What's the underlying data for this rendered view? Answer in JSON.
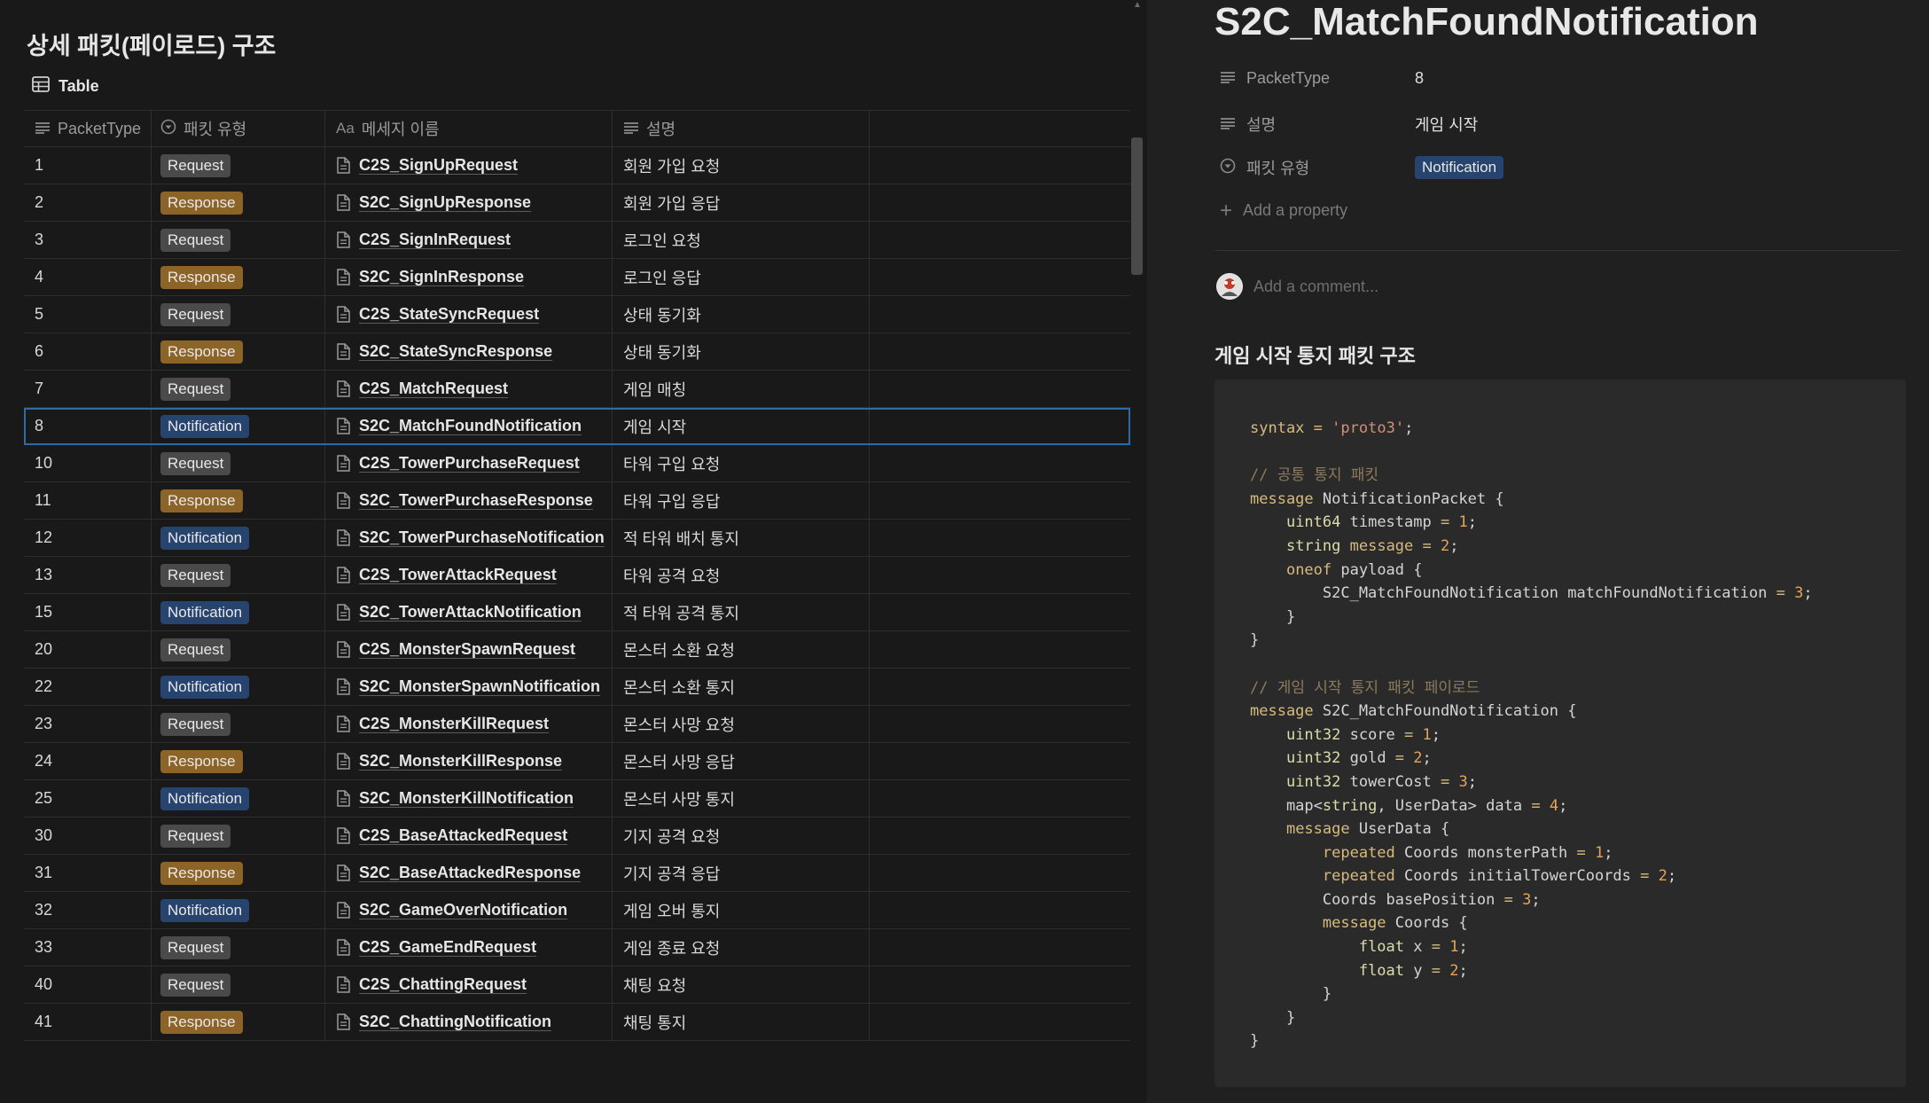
{
  "database": {
    "title": "상세 패킷(페이로드) 구조",
    "view_label": "Table",
    "columns": [
      "PacketType",
      "패킷 유형",
      "메세지 이름",
      "설명"
    ],
    "rows": [
      {
        "packet_type": "1",
        "kind": "Request",
        "name": "C2S_SignUpRequest",
        "desc": "회원 가입 요청"
      },
      {
        "packet_type": "2",
        "kind": "Response",
        "name": "S2C_SignUpResponse",
        "desc": "회원 가입 응답"
      },
      {
        "packet_type": "3",
        "kind": "Request",
        "name": "C2S_SignInRequest",
        "desc": "로그인 요청"
      },
      {
        "packet_type": "4",
        "kind": "Response",
        "name": "S2C_SignInResponse",
        "desc": "로그인 응답"
      },
      {
        "packet_type": "5",
        "kind": "Request",
        "name": "C2S_StateSyncRequest",
        "desc": "상태 동기화"
      },
      {
        "packet_type": "6",
        "kind": "Response",
        "name": "S2C_StateSyncResponse",
        "desc": "상태 동기화"
      },
      {
        "packet_type": "7",
        "kind": "Request",
        "name": "C2S_MatchRequest",
        "desc": "게임 매칭"
      },
      {
        "packet_type": "8",
        "kind": "Notification",
        "name": "S2C_MatchFoundNotification",
        "desc": "게임 시작"
      },
      {
        "packet_type": "10",
        "kind": "Request",
        "name": "C2S_TowerPurchaseRequest",
        "desc": "타워 구입 요청"
      },
      {
        "packet_type": "11",
        "kind": "Response",
        "name": "S2C_TowerPurchaseResponse",
        "desc": "타워 구입 응답"
      },
      {
        "packet_type": "12",
        "kind": "Notification",
        "name": "S2C_TowerPurchaseNotification",
        "desc": "적 타워 배치 통지"
      },
      {
        "packet_type": "13",
        "kind": "Request",
        "name": "C2S_TowerAttackRequest",
        "desc": "타워 공격 요청"
      },
      {
        "packet_type": "15",
        "kind": "Notification",
        "name": "S2C_TowerAttackNotification",
        "desc": "적 타워 공격 통지"
      },
      {
        "packet_type": "20",
        "kind": "Request",
        "name": "C2S_MonsterSpawnRequest",
        "desc": "몬스터 소환 요청"
      },
      {
        "packet_type": "22",
        "kind": "Notification",
        "name": "S2C_MonsterSpawnNotification",
        "desc": "몬스터 소환 통지"
      },
      {
        "packet_type": "23",
        "kind": "Request",
        "name": "C2S_MonsterKillRequest",
        "desc": "몬스터 사망 요청"
      },
      {
        "packet_type": "24",
        "kind": "Response",
        "name": "S2C_MonsterKillResponse",
        "desc": "몬스터 사망 응답"
      },
      {
        "packet_type": "25",
        "kind": "Notification",
        "name": "S2C_MonsterKillNotification",
        "desc": "몬스터 사망 통지"
      },
      {
        "packet_type": "30",
        "kind": "Request",
        "name": "C2S_BaseAttackedRequest",
        "desc": "기지 공격 요청"
      },
      {
        "packet_type": "31",
        "kind": "Response",
        "name": "S2C_BaseAttackedResponse",
        "desc": "기지 공격 응답"
      },
      {
        "packet_type": "32",
        "kind": "Notification",
        "name": "S2C_GameOverNotification",
        "desc": "게임 오버 통지"
      },
      {
        "packet_type": "33",
        "kind": "Request",
        "name": "C2S_GameEndRequest",
        "desc": "게임 종료 요청"
      },
      {
        "packet_type": "40",
        "kind": "Request",
        "name": "C2S_ChattingRequest",
        "desc": "채팅 요청"
      },
      {
        "packet_type": "41",
        "kind": "Response",
        "name": "S2C_ChattingNotification",
        "desc": "채팅 통지"
      }
    ],
    "selected_row": 7
  },
  "detail": {
    "title": "S2C_MatchFoundNotification",
    "properties": [
      {
        "name": "PacketType",
        "value": "8",
        "icon": "text-lines-icon"
      },
      {
        "name": "설명",
        "value": "게임 시작",
        "icon": "text-lines-icon"
      },
      {
        "name": "패킷 유형",
        "value": "Notification",
        "icon": "select-circle-icon"
      }
    ],
    "add_property_label": "Add a property",
    "comment_placeholder": "Add a comment...",
    "section_heading": "게임 시작 통지 패킷 구조",
    "code_lines": [
      "syntax = 'proto3';",
      "",
      "// 공통 통지 패킷",
      "message NotificationPacket {",
      "    uint64 timestamp = 1;",
      "    string message = 2;",
      "    oneof payload {",
      "        S2C_MatchFoundNotification matchFoundNotification = 3;",
      "    }",
      "}",
      "",
      "// 게임 시작 통지 패킷 페이로드",
      "message S2C_MatchFoundNotification {",
      "    uint32 score = 1;",
      "    uint32 gold = 2;",
      "    uint32 towerCost = 3;",
      "    map<string, UserData> data = 4;",
      "    message UserData {",
      "        repeated Coords monsterPath = 1;",
      "        repeated Coords initialTowerCoords = 2;",
      "        Coords basePosition = 3;",
      "        message Coords {",
      "            float x = 1;",
      "            float y = 2;",
      "        }",
      "    }",
      "}"
    ]
  },
  "colors": {
    "request_tag": "#4a4a4a",
    "response_tag": "#8d6428",
    "notification_tag": "#27446e",
    "selection_outline": "#2d6aa8"
  }
}
